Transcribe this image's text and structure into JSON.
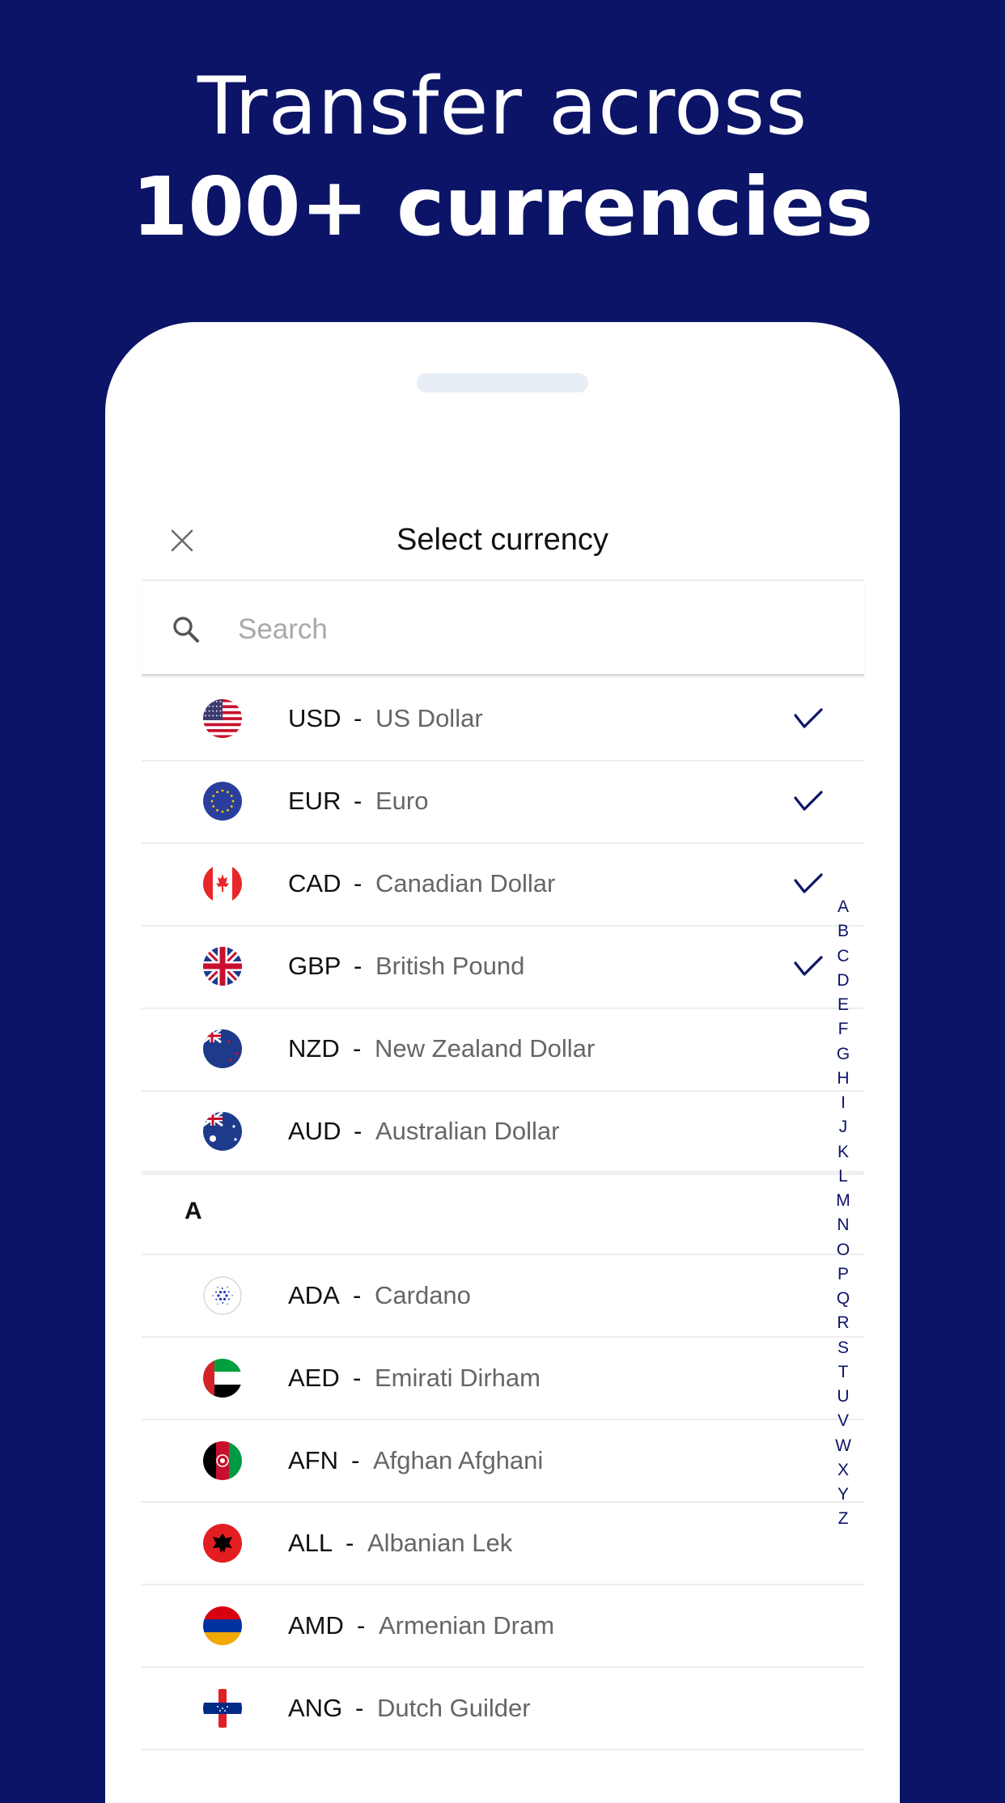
{
  "headline": {
    "line1": "Transfer across",
    "line2": "100+ currencies"
  },
  "colors": {
    "background": "#0c1468",
    "accent": "#0c1468",
    "code_text": "#111111",
    "name_text": "#666666",
    "separator": "#ededed"
  },
  "modal": {
    "title": "Select currency",
    "close_icon": "close-icon",
    "search": {
      "placeholder": "Search",
      "value": "",
      "icon": "search-icon"
    }
  },
  "selected_currencies": [
    {
      "code": "USD",
      "name": "US Dollar",
      "flag": "us",
      "checked": true
    },
    {
      "code": "EUR",
      "name": "Euro",
      "flag": "eu",
      "checked": true
    },
    {
      "code": "CAD",
      "name": "Canadian Dollar",
      "flag": "ca",
      "checked": true
    },
    {
      "code": "GBP",
      "name": "British Pound",
      "flag": "gb",
      "checked": true
    },
    {
      "code": "NZD",
      "name": "New Zealand Dollar",
      "flag": "nz",
      "checked": false
    },
    {
      "code": "AUD",
      "name": "Australian Dollar",
      "flag": "au",
      "checked": false
    }
  ],
  "sections": [
    {
      "letter": "A",
      "items": [
        {
          "code": "ADA",
          "name": "Cardano",
          "flag": "ada"
        },
        {
          "code": "AED",
          "name": "Emirati Dirham",
          "flag": "ae"
        },
        {
          "code": "AFN",
          "name": "Afghan Afghani",
          "flag": "af"
        },
        {
          "code": "ALL",
          "name": "Albanian Lek",
          "flag": "al"
        },
        {
          "code": "AMD",
          "name": "Armenian Dram",
          "flag": "am"
        },
        {
          "code": "ANG",
          "name": "Dutch Guilder",
          "flag": "an"
        }
      ]
    }
  ],
  "dash": "-",
  "alphabet_index": [
    "A",
    "B",
    "C",
    "D",
    "E",
    "F",
    "G",
    "H",
    "I",
    "J",
    "K",
    "L",
    "M",
    "N",
    "O",
    "P",
    "Q",
    "R",
    "S",
    "T",
    "U",
    "V",
    "W",
    "X",
    "Y",
    "Z"
  ]
}
